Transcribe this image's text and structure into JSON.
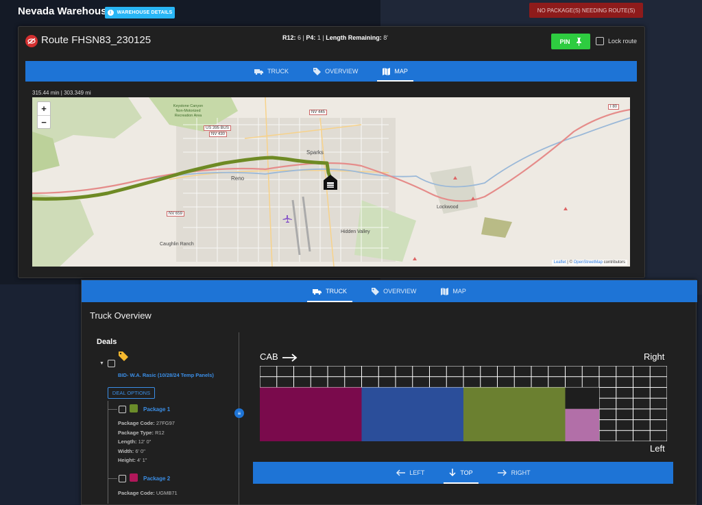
{
  "warehouse": {
    "title": "Nevada Warehouse",
    "details_button": "WAREHOUSE DETAILS",
    "info_glyph": "i",
    "alert": "NO PACKAGE(S) NEEDING ROUTE(S)"
  },
  "route": {
    "title": "Route FHSN83_230125",
    "stats": {
      "r12_label": "R12:",
      "r12_value": " 6 | ",
      "p4_label": "P4:",
      "p4_value": " 1 | ",
      "len_label": "Length Remaining:",
      "len_value": " 8'"
    },
    "pin_label": "PIN",
    "lock_label": "Lock route",
    "tabs": [
      {
        "label": "TRUCK",
        "icon": "truck-icon"
      },
      {
        "label": "OVERVIEW",
        "icon": "tag-icon"
      },
      {
        "label": "MAP",
        "icon": "map-icon"
      }
    ],
    "active_tab": "MAP",
    "map_meta": "315.44 min | 303.349 mi",
    "map": {
      "zoom_in": "+",
      "zoom_out": "−",
      "attribution_leaflet": "Leaflet",
      "attribution_sep": " | © ",
      "attribution_osm": "OpenStreetMap",
      "attribution_tail": " contributors",
      "labels": {
        "reno": "Reno",
        "sparks": "Sparks",
        "hidden_valley": "Hidden Valley",
        "lockwood": "Lockwood",
        "caughlin": "Caughlin Ranch",
        "keystone": "Keystone Canyon Non-Motorized Recreation Area",
        "us395": "US 395 BUS",
        "nv430": "NV 430",
        "nv445": "NV 445",
        "nv659": "NV 659",
        "i80": "I 80"
      }
    }
  },
  "truck": {
    "tabs": [
      {
        "label": "TRUCK",
        "icon": "truck-icon"
      },
      {
        "label": "OVERVIEW",
        "icon": "tag-icon"
      },
      {
        "label": "MAP",
        "icon": "map-icon"
      }
    ],
    "active_tab": "TRUCK",
    "title": "Truck Overview",
    "deals_title": "Deals",
    "deal_name": "BID- W.A. Rasic (10/28/24 Temp Panels)",
    "deal_options": "DEAL OPTIONS",
    "packages": [
      {
        "name": "Package 1",
        "color": "#6b8c2a",
        "details": [
          {
            "k": "Package Code:",
            "v": " 27FG97"
          },
          {
            "k": "Package Type:",
            "v": " R12"
          },
          {
            "k": "Length:",
            "v": " 12' 0\""
          },
          {
            "k": "Width:",
            "v": " 6' 0\""
          },
          {
            "k": "Height:",
            "v": " 4' 1\""
          }
        ]
      },
      {
        "name": "Package 2",
        "color": "#b0175a",
        "details": [
          {
            "k": "Package Code:",
            "v": " UGMB71"
          }
        ]
      }
    ],
    "layout": {
      "cab_label": "CAB",
      "right_label": "Right",
      "left_label": "Left",
      "cols": 24,
      "rows": 7,
      "blocks": [
        {
          "color": "#7a0a4c",
          "col": 0,
          "row": 2,
          "w": 6,
          "h": 5
        },
        {
          "color": "#2b4e9a",
          "col": 6,
          "row": 2,
          "w": 6,
          "h": 5
        },
        {
          "color": "#6b8030",
          "col": 12,
          "row": 2,
          "w": 6,
          "h": 5
        },
        {
          "color": "#1e1e1e",
          "col": 18,
          "row": 2,
          "w": 2,
          "h": 2
        },
        {
          "color": "#b26fa8",
          "col": 18,
          "row": 4,
          "w": 2,
          "h": 3
        }
      ]
    },
    "view_tabs": [
      {
        "label": "LEFT",
        "icon": "arrow-left-icon"
      },
      {
        "label": "TOP",
        "icon": "arrow-down-icon"
      },
      {
        "label": "RIGHT",
        "icon": "arrow-right-icon"
      }
    ],
    "active_view": "TOP",
    "drag_glyph": "≡"
  }
}
